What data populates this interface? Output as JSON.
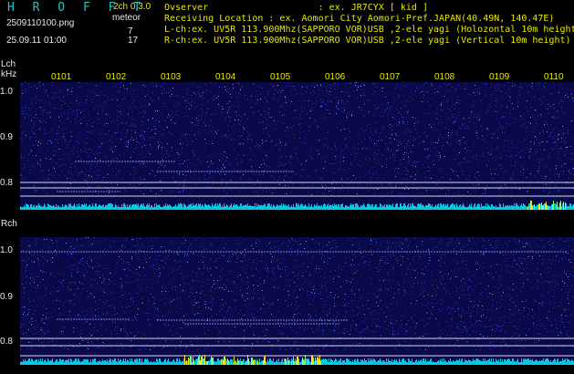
{
  "header": {
    "brand": "H R O F F T",
    "version": "2ch 0.3.0",
    "filename": "2509110100.png",
    "meteor_label": "meteor",
    "meteor_lch": "7",
    "meteor_rch": "17",
    "datetime": "25.09.11 01:00",
    "info_lines": [
      "Ovserver                    : ex. JR7CYX [ kid ]",
      "Receiving Location : ex. Aomori City Aomori-Pref.JAPAN(40.49N, 140.47E)",
      "L-ch:ex. UV5R 113.900Mhz(SAPPORO VOR)USB ,2-ele yagi (Holozontal 10m height",
      "R-ch:ex. UV5R 113.900Mhz(SAPPORO VOR)USB ,2-ele yagi (Vertical 10m height)"
    ]
  },
  "axis": {
    "time_ticks": [
      "0101",
      "0102",
      "0103",
      "0104",
      "0105",
      "0106",
      "0107",
      "0108",
      "0109",
      "0110"
    ],
    "khz_label": "kHz"
  },
  "channels": [
    {
      "name": "Lch",
      "freq_ticks": [
        "1.0",
        "0.9",
        "0.8"
      ]
    },
    {
      "name": "Rch",
      "freq_ticks": [
        "1.0",
        "0.9",
        "0.8"
      ]
    }
  ],
  "colors": {
    "background": "#000000",
    "waterfall_base": "#0a0a4a",
    "noise": "#3a4ad0",
    "level_bar": "#00c8e0",
    "level_peak": "#f0f000",
    "text_yellow": "#e8e800",
    "text_cyan": "#18c8c8",
    "text_white": "#e8e8e8"
  }
}
